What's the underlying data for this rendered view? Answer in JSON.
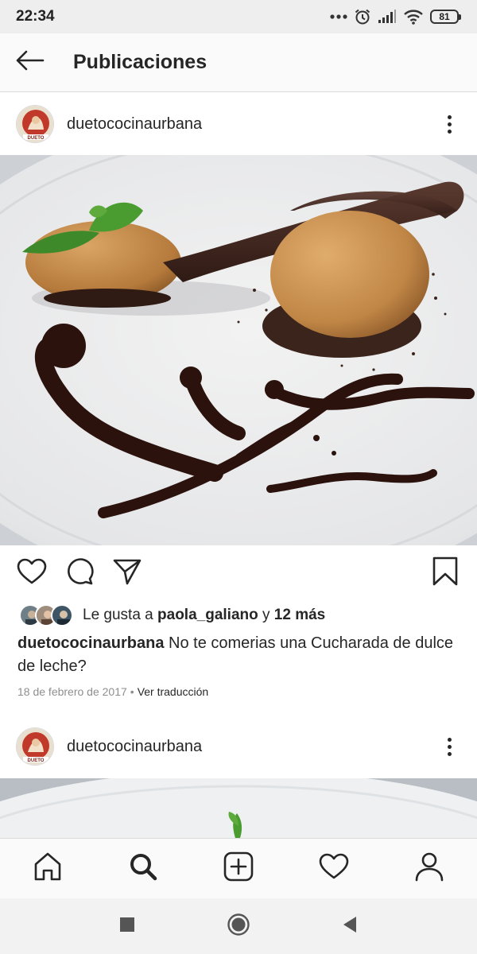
{
  "status_bar": {
    "time": "22:34",
    "battery": "81",
    "icons": [
      "dots-icon",
      "alarm-icon",
      "signal-icon",
      "wifi-icon",
      "battery-icon"
    ]
  },
  "top_nav": {
    "back_icon": "arrow-left-icon",
    "title": "Publicaciones"
  },
  "posts": [
    {
      "username": "duetococinaurbana",
      "image_alt": "",
      "likes": {
        "prefix": "Le gusta a ",
        "liker": "paola_galiano",
        "conjunction": " y ",
        "others": "12 más"
      },
      "caption": {
        "username": "duetococinaurbana",
        "text": " No te comerias una Cucharada de dulce de leche?"
      },
      "date": "18 de febrero de 2017",
      "separator": "•",
      "translate": "Ver traducción"
    },
    {
      "username": "duetococinaurbana"
    }
  ],
  "bottom_nav": [
    "home-icon",
    "search-icon",
    "new-post-icon",
    "activity-heart-icon",
    "profile-icon"
  ],
  "system_nav": [
    "recents-square-icon",
    "home-circle-icon",
    "back-triangle-icon"
  ],
  "colors": {
    "text": "#262626",
    "muted": "#8e8e8e",
    "border": "#dbdbdb",
    "chocolate": "#2b120d",
    "caramel": "#c48a4a"
  }
}
